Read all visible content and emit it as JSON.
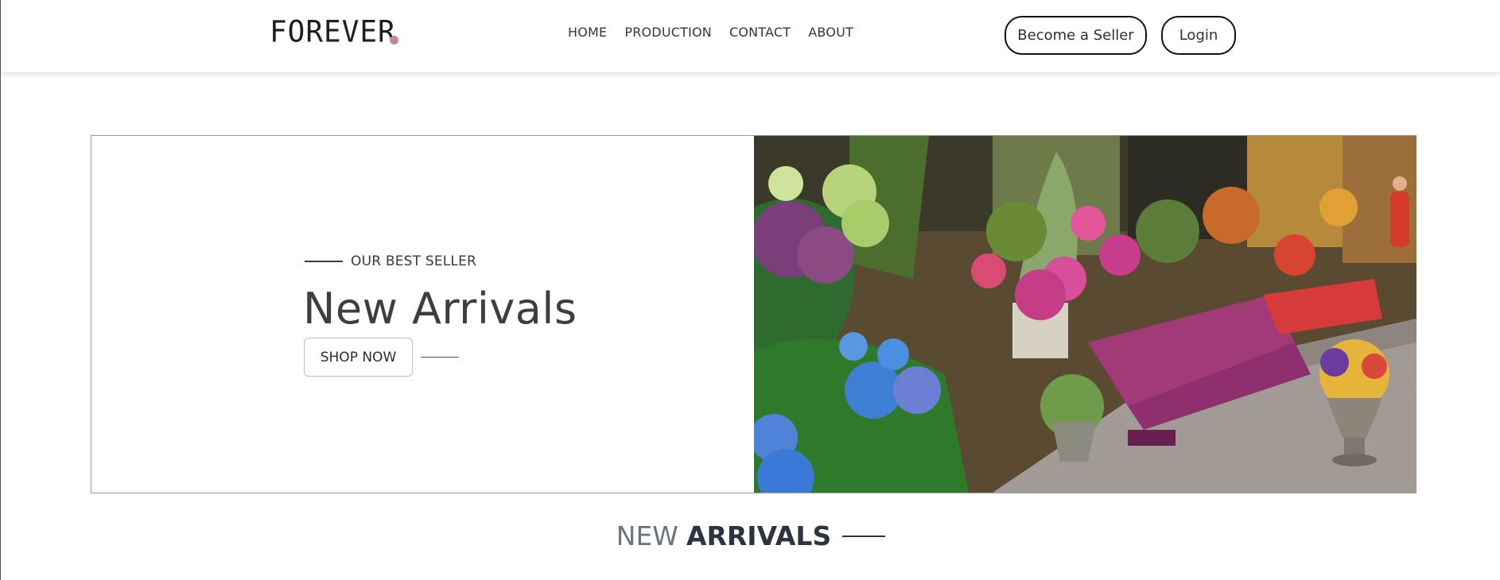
{
  "header": {
    "logo_text": "FOREVER",
    "logo_dot_color": "#c586a5",
    "nav": [
      "HOME",
      "PRODUCTION",
      "CONTACT",
      "ABOUT"
    ],
    "become_seller_label": "Become a Seller",
    "login_label": "Login"
  },
  "hero": {
    "eyebrow": "OUR BEST SELLER",
    "title": "New Arrivals",
    "cta_label": "SHOP NOW",
    "image_alt": "flower-market-photo"
  },
  "section": {
    "title_light": "NEW",
    "title_bold": "ARRIVALS"
  }
}
